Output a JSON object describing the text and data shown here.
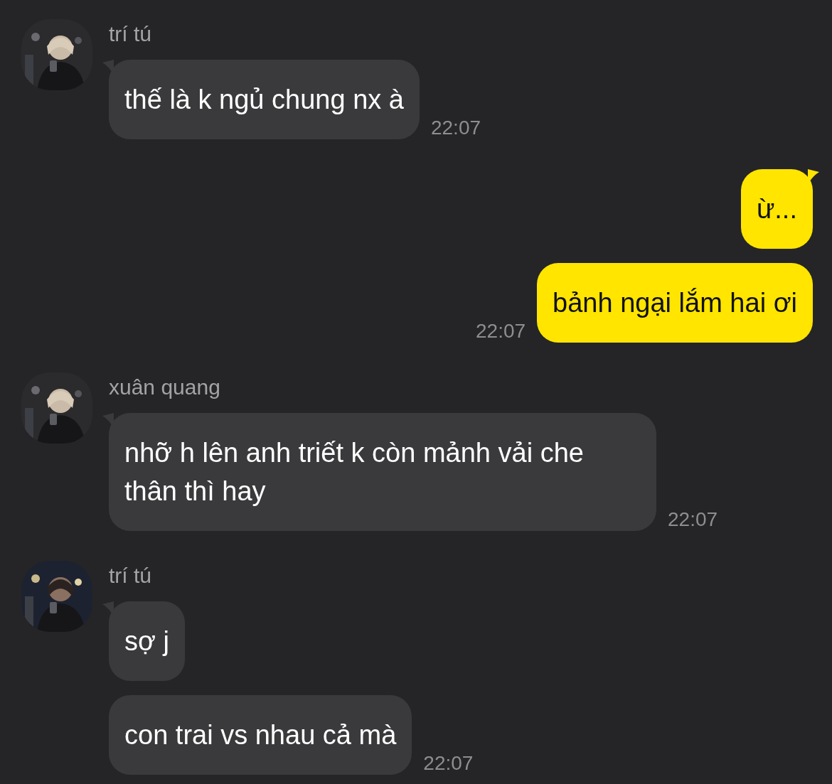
{
  "groups": [
    {
      "kind": "incoming",
      "sender": "trí tú",
      "avatar": {
        "kind": "picture"
      },
      "messages": [
        {
          "text": "thế là k ngủ chung nx à"
        }
      ],
      "time": "22:07"
    },
    {
      "kind": "outgoing",
      "messages": [
        {
          "text": "ừ..."
        },
        {
          "text": "bảnh ngại lắm hai ơi"
        }
      ],
      "time": "22:07"
    },
    {
      "kind": "incoming",
      "sender": "xuân quang",
      "avatar": {
        "kind": "picture"
      },
      "messages": [
        {
          "text": "nhỡ h lên anh triết k còn mảnh vải che thân thì hay"
        }
      ],
      "time": "22:07"
    },
    {
      "kind": "incoming",
      "sender": "trí tú",
      "avatar": {
        "kind": "picture"
      },
      "messages": [
        {
          "text": "sợ j"
        },
        {
          "text": "con trai vs nhau cả mà"
        }
      ],
      "time": "22:07"
    }
  ]
}
